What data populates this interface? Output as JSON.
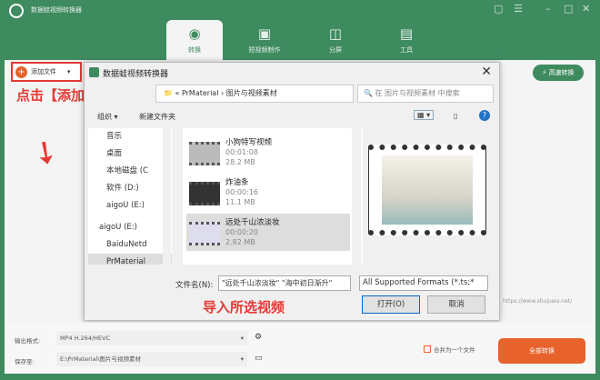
{
  "app": {
    "title": "数据蛙视频转换器"
  },
  "tabs": [
    {
      "label": "转换",
      "icon": "convert-icon"
    },
    {
      "label": "短视频制作",
      "icon": "tv-icon"
    },
    {
      "label": "分屏",
      "icon": "split-screen-icon"
    },
    {
      "label": "工具",
      "icon": "toolbox-icon"
    }
  ],
  "toolbar": {
    "add_file": "添加文件",
    "fast_convert": "高速转换"
  },
  "annotations": {
    "click_hint": "点击【添加文件】",
    "import_hint": "导入所选视频"
  },
  "dialog": {
    "title": "数据蛙视频转换器",
    "breadcrumb": [
      "PrMaterial",
      "图片与视频素材"
    ],
    "search_placeholder": "在 图片与视频素材 中搜索",
    "organize": "组织 ▾",
    "new_folder": "新建文件夹",
    "nav": [
      "音乐",
      "桌面",
      "本地磁盘 (C",
      "软件 (D:)",
      "aigoU (E:)",
      "aigoU (E:)",
      "BaiduNetd",
      "PrMaterial"
    ],
    "files": [
      {
        "name": "小狗特写视频",
        "duration": "00:01:08",
        "size": "28.2 MB"
      },
      {
        "name": "炸油条",
        "duration": "00:00:16",
        "size": "11.1 MB"
      },
      {
        "name": "远处千山浓淡妆",
        "duration": "00:00:20",
        "size": "2.82 MB"
      }
    ],
    "filename_label": "文件名(N):",
    "filename_value": "\"远处千山浓淡妆\" \"海中初日渐升\"",
    "format": "All Supported Formats (*.ts;*",
    "open": "打开(O)",
    "cancel": "取消"
  },
  "url": "https://www.shujuwa.net/",
  "bottom": {
    "output_label": "输出格式:",
    "output_value": "MP4 H.264/HEVC",
    "save_label": "保存至:",
    "save_value": "E:\\PrMaterial\\图片与视频素材",
    "merge": "合并为一个文件",
    "convert_all": "全部转换"
  }
}
